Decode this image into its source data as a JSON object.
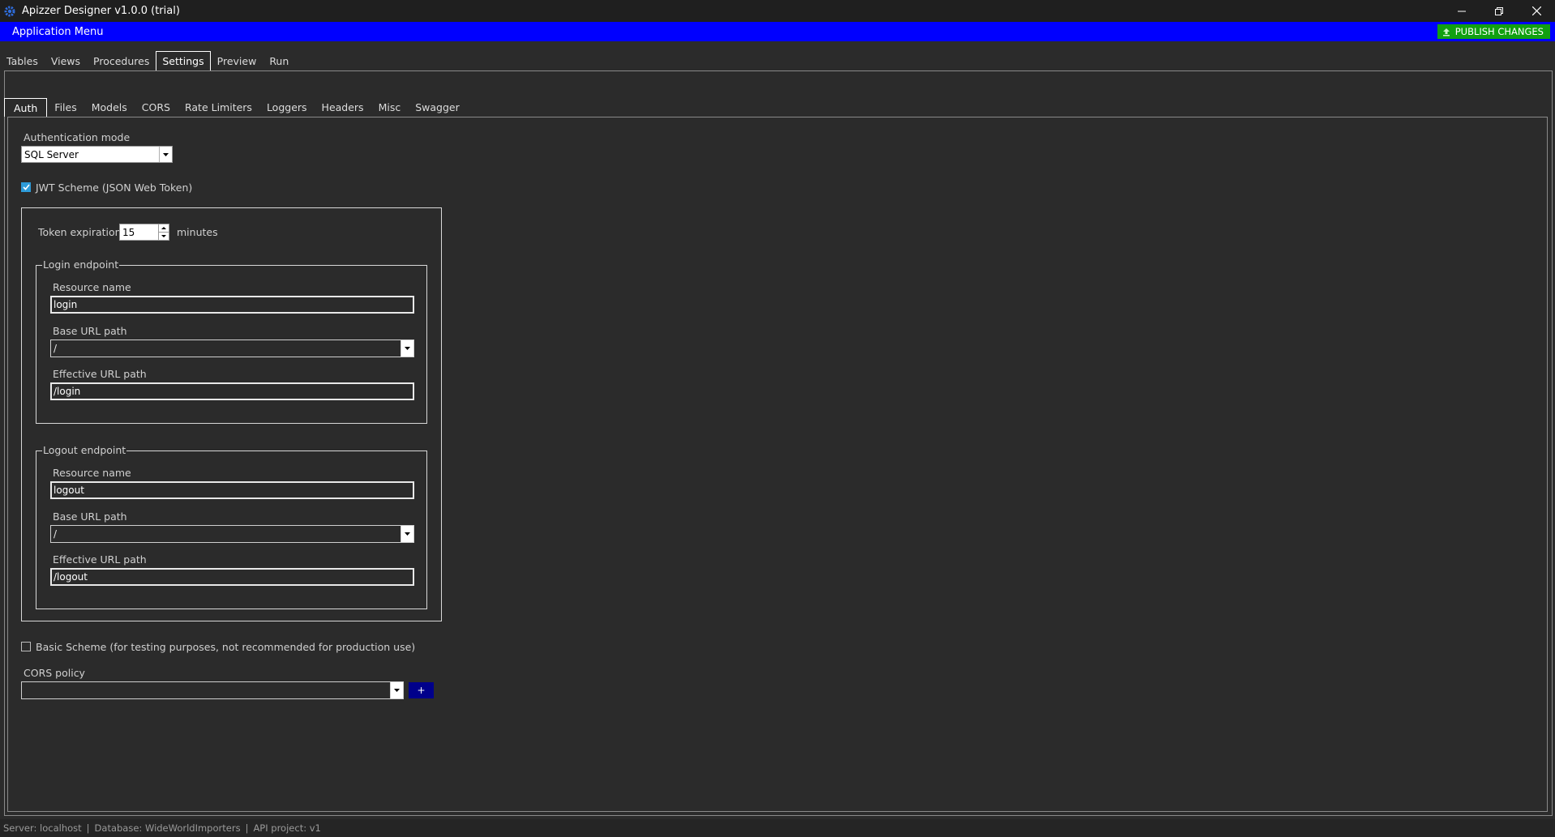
{
  "window": {
    "title": "Apizzer Designer v1.0.0 (trial)",
    "app_icon": "gear-icon",
    "controls": [
      "minimize-icon",
      "restore-icon",
      "close-icon"
    ]
  },
  "menu": {
    "app_menu_label": "Application Menu",
    "publish_label": "PUBLISH CHANGES",
    "publish_icon": "upload-icon",
    "colors": {
      "menu_bg": "#0000ff",
      "publish_bg": "#11a011"
    }
  },
  "top_tabs": [
    "Tables",
    "Views",
    "Procedures",
    "Settings",
    "Preview",
    "Run"
  ],
  "top_tab_active": "Settings",
  "sub_tabs": [
    "Auth",
    "Files",
    "Models",
    "CORS",
    "Rate Limiters",
    "Loggers",
    "Headers",
    "Misc",
    "Swagger"
  ],
  "sub_tab_active": "Auth",
  "auth": {
    "auth_mode_label": "Authentication mode",
    "auth_mode_value": "SQL Server",
    "jwt": {
      "label": "JWT Scheme (JSON Web Token)",
      "checked": true,
      "token_expiration_label": "Token expiration:",
      "token_expiration_value": "15",
      "token_expiration_unit": "minutes",
      "login": {
        "legend": "Login endpoint",
        "resource_name_label": "Resource name",
        "resource_name_value": "login",
        "base_url_label": "Base URL path",
        "base_url_value": "/",
        "effective_url_label": "Effective URL path",
        "effective_url_value": "/login"
      },
      "logout": {
        "legend": "Logout endpoint",
        "resource_name_label": "Resource name",
        "resource_name_value": "logout",
        "base_url_label": "Base URL path",
        "base_url_value": "/",
        "effective_url_label": "Effective URL path",
        "effective_url_value": "/logout"
      }
    },
    "basic": {
      "label": "Basic Scheme (for testing purposes, not recommended for production use)",
      "checked": false
    },
    "cors_policy_label": "CORS policy",
    "cors_policy_value": "",
    "add_cors_label": "+"
  },
  "status": {
    "server": "Server: localhost",
    "database": "Database: WideWorldImporters",
    "project": "API project: v1",
    "separator": "|"
  }
}
